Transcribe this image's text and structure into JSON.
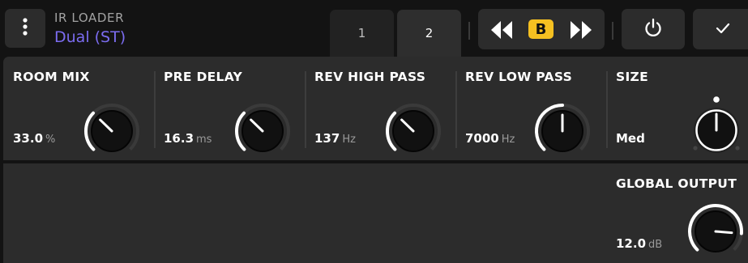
{
  "header": {
    "menu_icon": "kebab-vertical-icon",
    "plugin_name": "IR LOADER",
    "preset_name": "Dual (ST)",
    "preset_color": "#7b6cf0"
  },
  "tabs": [
    {
      "label": "1",
      "active": false
    },
    {
      "label": "2",
      "active": true
    }
  ],
  "ab_compare": {
    "prev_icon": "skip-previous-icon",
    "badge": "B",
    "badge_color": "#f5c021",
    "next_icon": "skip-next-icon"
  },
  "controls": {
    "power_icon": "power-icon",
    "confirm_icon": "checkmark-icon"
  },
  "params": [
    {
      "label": "ROOM MIX",
      "value": "33.0",
      "unit": "%",
      "knob_level": 0.33
    },
    {
      "label": "PRE DELAY",
      "value": "16.3",
      "unit": "ms",
      "knob_level": 0.33
    },
    {
      "label": "REV HIGH PASS",
      "value": "137",
      "unit": "Hz",
      "knob_level": 0.33
    },
    {
      "label": "REV LOW PASS",
      "value": "7000",
      "unit": "Hz",
      "knob_level": 0.5
    },
    {
      "label": "SIZE",
      "value": "Med",
      "unit": "",
      "knob_level": 0.5
    }
  ],
  "global_output": {
    "label": "GLOBAL OUTPUT",
    "value": "12.0",
    "unit": "dB",
    "knob_level": 0.85
  },
  "colors": {
    "background": "#131313",
    "panel": "#2c2c2c",
    "accent": "#f5c021",
    "knob_arc": "#ffffff",
    "knob_track": "#3a3a3a"
  }
}
